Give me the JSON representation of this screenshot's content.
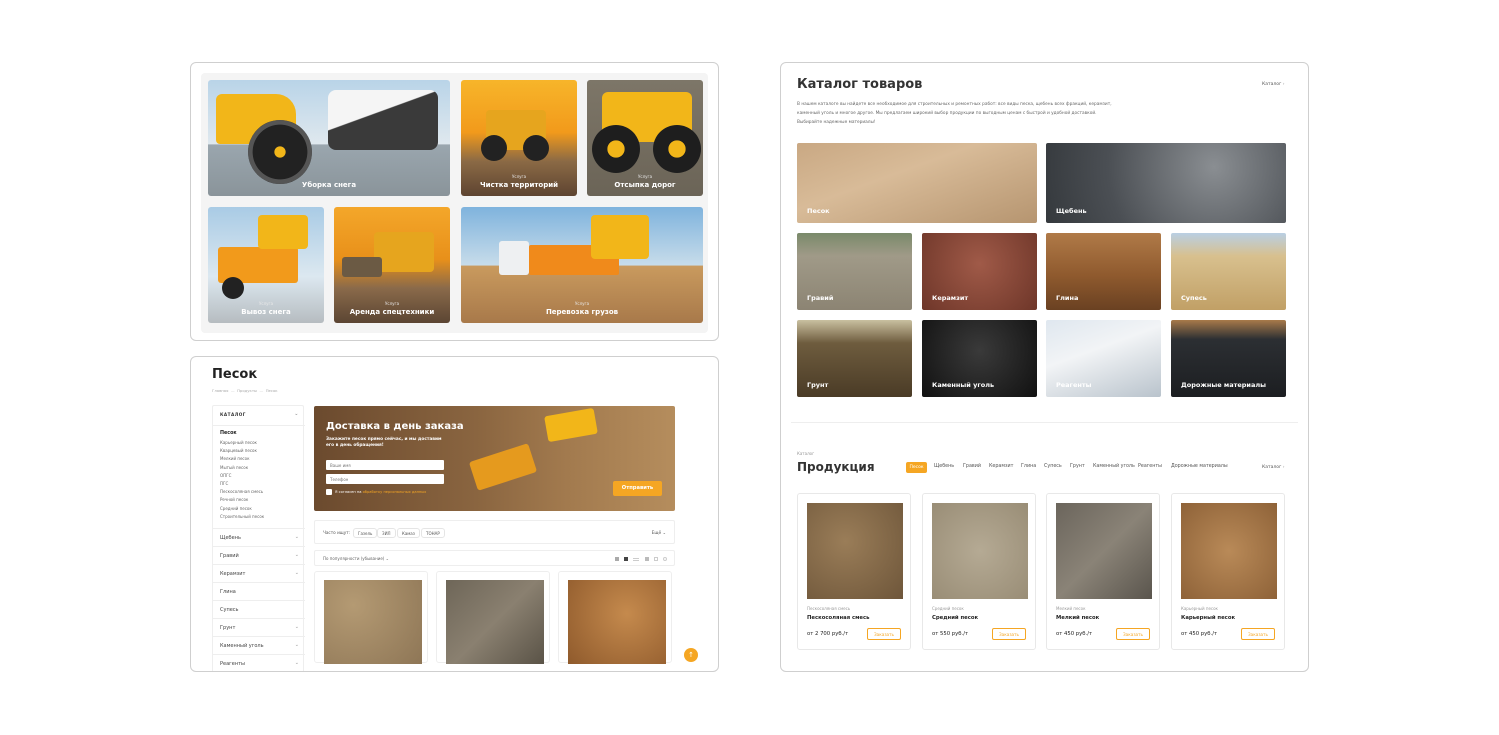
{
  "services": [
    {
      "label": "Уборка снега",
      "sub": ""
    },
    {
      "label": "Чистка территорий",
      "sub": "Услуга"
    },
    {
      "label": "Отсыпка дорог",
      "sub": "Услуга"
    },
    {
      "label": "Вывоз снега",
      "sub": "Услуга"
    },
    {
      "label": "Аренда спецтехники",
      "sub": "Услуга"
    },
    {
      "label": "Перевозка грузов",
      "sub": "Услуга"
    }
  ],
  "sand_page": {
    "title": "Песок",
    "breadcrumbs": [
      "Главная",
      "Продукты",
      "Песок"
    ],
    "sidebar_title": "КАТАЛОГ",
    "sidebar_active": "Песок",
    "sidebar_sub": [
      "Карьерный песок",
      "Кварцевый песок",
      "Мелкий песок",
      "Мытый песок",
      "ОПГС",
      "ПГС",
      "Пескосоляная смесь",
      "Речной песок",
      "Средний песок",
      "Строительный песок"
    ],
    "sidebar_items": [
      "Щебень",
      "Гравий",
      "Керамзит",
      "Глина",
      "Супесь",
      "Грунт",
      "Каменный уголь",
      "Реагенты"
    ],
    "banner": {
      "title": "Доставка в день заказа",
      "text": "Закажите песок прямо сейчас, и мы доставим его в день обращения!",
      "name_placeholder": "Ваше имя",
      "phone_placeholder": "Телефон",
      "consent": "Я согласен на",
      "consent_link": "обработку персональных данных",
      "button": "Отправить"
    },
    "often_label": "Часто ищут:",
    "often_chips": [
      "Газель",
      "ЗИЛ",
      "Камаз",
      "ТОНАР"
    ],
    "more": "Ещё",
    "sort_label": "По популярности (убывание)",
    "scroll_up": "↑"
  },
  "catalog": {
    "title": "Каталог товаров",
    "link": "Каталог",
    "description": [
      "В нашем каталоге вы найдете все необходимое для строительных и ремонтных работ: все виды песка, щебень всех фракций, керамзит,",
      "каменный уголь и многое другое. Мы предлагаем широкий выбор продукции по выгодным ценам с быстрой и удобной доставкой.",
      "Выбирайте надежные материалы!"
    ],
    "categories": [
      "Песок",
      "Щебень",
      "Гравий",
      "Керамзит",
      "Глина",
      "Супесь",
      "Грунт",
      "Каменный уголь",
      "Реагенты",
      "Дорожные материалы"
    ]
  },
  "products": {
    "overline": "Каталог",
    "title": "Продукция",
    "tabs": [
      "Песок",
      "Щебень",
      "Гравий",
      "Керамзит",
      "Глина",
      "Супесь",
      "Грунт",
      "Каменный уголь",
      "Реагенты",
      "Дорожные материалы"
    ],
    "active_tab": "Песок",
    "link": "Каталог",
    "items": [
      {
        "category": "Пескосоляная смесь",
        "name": "Пескосоляная смесь",
        "price": "от 2 700 руб./т",
        "button": "Заказать"
      },
      {
        "category": "Средний песок",
        "name": "Средний песок",
        "price": "от 550 руб./т",
        "button": "Заказать"
      },
      {
        "category": "Мелкий песок",
        "name": "Мелкий песок",
        "price": "от 450 руб./т",
        "button": "Заказать"
      },
      {
        "category": "Карьерный песок",
        "name": "Карьерный песок",
        "price": "от 450 руб./т",
        "button": "Заказать"
      }
    ]
  },
  "colors": {
    "accent": "#f5a623",
    "border": "#cfcfcf"
  }
}
